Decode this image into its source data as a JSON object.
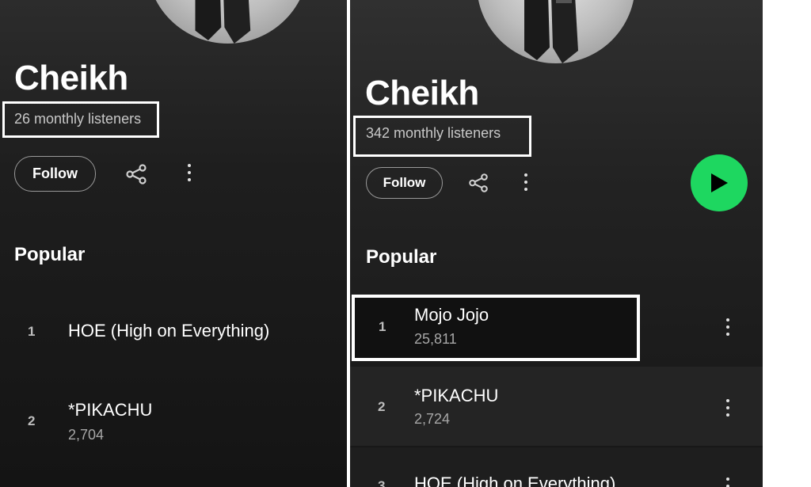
{
  "left": {
    "artist_name": "Cheikh",
    "monthly_listeners": "26 monthly listeners",
    "follow_label": "Follow",
    "section_title": "Popular",
    "tracks": [
      {
        "num": "1",
        "title": "HOE (High on Everything)",
        "plays": ""
      },
      {
        "num": "2",
        "title": "*PIKACHU",
        "plays": "2,704"
      }
    ]
  },
  "right": {
    "artist_name": "Cheikh",
    "monthly_listeners": "342 monthly listeners",
    "follow_label": "Follow",
    "section_title": "Popular",
    "tracks": [
      {
        "num": "1",
        "title": "Mojo Jojo",
        "plays": "25,811"
      },
      {
        "num": "2",
        "title": "*PIKACHU",
        "plays": "2,724"
      },
      {
        "num": "3",
        "title": "HOE (High on Everything)",
        "plays": ""
      }
    ]
  },
  "icons": {
    "share": "share-icon",
    "more": "more-options-icon",
    "play": "play-icon"
  },
  "colors": {
    "accent_green": "#1ed760",
    "highlight_box": "#ffffff",
    "background": "#121212"
  }
}
